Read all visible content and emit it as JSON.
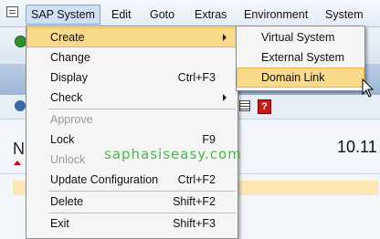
{
  "menubar": {
    "items": [
      "SAP System",
      "Edit",
      "Goto",
      "Extras",
      "Environment",
      "System"
    ]
  },
  "menu": {
    "items": [
      {
        "label": "Create",
        "shortcut": "",
        "submenu": true,
        "highlighted": true,
        "disabled": false
      },
      {
        "label": "Change",
        "shortcut": "",
        "submenu": false,
        "highlighted": false,
        "disabled": false
      },
      {
        "label": "Display",
        "shortcut": "Ctrl+F3",
        "submenu": false,
        "highlighted": false,
        "disabled": false
      },
      {
        "label": "Check",
        "shortcut": "",
        "submenu": true,
        "highlighted": false,
        "disabled": false
      },
      {
        "label": "Approve",
        "shortcut": "",
        "submenu": false,
        "highlighted": false,
        "disabled": true
      },
      {
        "label": "Lock",
        "shortcut": "F9",
        "submenu": false,
        "highlighted": false,
        "disabled": false
      },
      {
        "label": "Unlock",
        "shortcut": "",
        "submenu": false,
        "highlighted": false,
        "disabled": true
      },
      {
        "label": "Update Configuration",
        "shortcut": "Ctrl+F2",
        "submenu": false,
        "highlighted": false,
        "disabled": false
      },
      {
        "label": "Delete",
        "shortcut": "Shift+F2",
        "submenu": false,
        "highlighted": false,
        "disabled": false
      },
      {
        "label": "Exit",
        "shortcut": "Shift+F3",
        "submenu": false,
        "highlighted": false,
        "disabled": false
      }
    ]
  },
  "submenu": {
    "items": [
      {
        "label": "Virtual System",
        "highlighted": false
      },
      {
        "label": "External System",
        "highlighted": false
      },
      {
        "label": "Domain Link",
        "highlighted": true
      }
    ]
  },
  "background": {
    "left_letter": "N",
    "right_number": "10.11"
  },
  "help_icon_glyph": "?",
  "watermark": "saphasiseasy.com",
  "colors": {
    "highlight": "#f9d98a",
    "watermark": "#48b848",
    "disabled_text": "#9a9a9a"
  }
}
